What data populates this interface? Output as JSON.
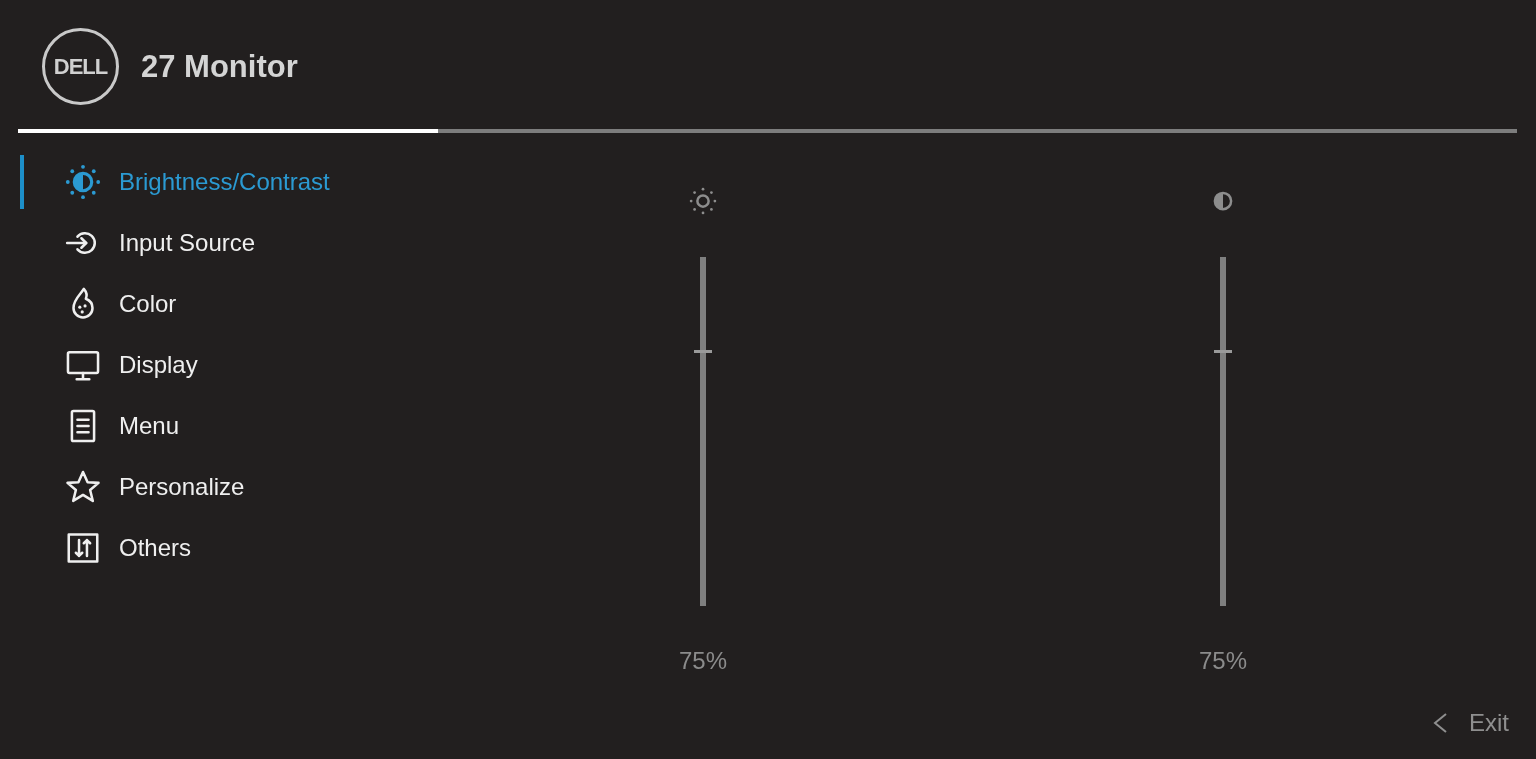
{
  "header": {
    "logo": "DELL",
    "title": "27 Monitor"
  },
  "menu_indicator": {
    "level": 0.28
  },
  "sidebar": {
    "items": [
      {
        "label": "Brightness/Contrast",
        "selected": true
      },
      {
        "label": "Input Source",
        "selected": false
      },
      {
        "label": "Color",
        "selected": false
      },
      {
        "label": "Display",
        "selected": false
      },
      {
        "label": "Menu",
        "selected": false
      },
      {
        "label": "Personalize",
        "selected": false
      },
      {
        "label": "Others",
        "selected": false
      }
    ]
  },
  "sliders": [
    {
      "level": 0.73,
      "reading": "75%"
    },
    {
      "level": 0.73,
      "reading": "75%"
    }
  ],
  "footer": {
    "exit_label": "Exit"
  }
}
